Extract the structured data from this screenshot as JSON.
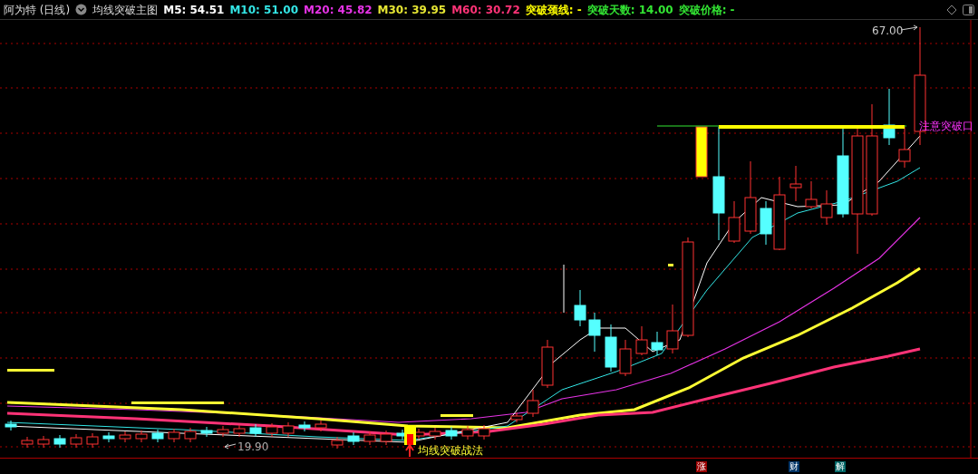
{
  "header": {
    "title": "阿为特 (日线)",
    "indicator": "均线突破主图",
    "values": [
      {
        "label": "M5: 54.51",
        "color": "#ffffff"
      },
      {
        "label": "M10: 51.00",
        "color": "#33e6e6"
      },
      {
        "label": "M20: 45.82",
        "color": "#e633e6"
      },
      {
        "label": "M30: 39.95",
        "color": "#e6e633"
      },
      {
        "label": "M60: 30.72",
        "color": "#ff3377"
      },
      {
        "label": "突破颈线: -",
        "color": "#ffff00"
      },
      {
        "label": "突破天数: 14.00",
        "color": "#33e633"
      },
      {
        "label": "突破价格: -",
        "color": "#33e633"
      }
    ]
  },
  "chart": {
    "high_label": "67.00",
    "low_label": "19.90",
    "breakout_note": "注意突破口",
    "signal_label": "均线突破战法"
  },
  "markers": [
    {
      "label": "涨",
      "color": "#990000"
    },
    {
      "label": "财",
      "color": "#003366"
    },
    {
      "label": "解",
      "color": "#006666"
    }
  ]
}
